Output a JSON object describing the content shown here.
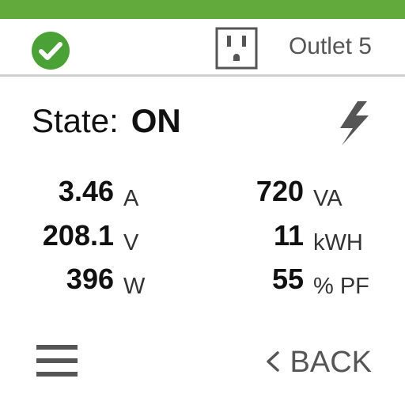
{
  "header": {
    "status_icon": "check-circle-icon",
    "status_color": "#4aa236",
    "accent_color": "#63aa3c",
    "outlet_icon": "power-outlet-icon",
    "outlet_title": "Outlet 5"
  },
  "state": {
    "label": "State:",
    "value": "ON",
    "icon": "lightning-bolt-icon"
  },
  "metrics": {
    "left": [
      {
        "value": "3.46",
        "unit": "A"
      },
      {
        "value": "208.1",
        "unit": "V"
      },
      {
        "value": "396",
        "unit": "W"
      }
    ],
    "right": [
      {
        "value": "720",
        "unit": "VA"
      },
      {
        "value": "11",
        "unit": "kWH"
      },
      {
        "value": "55",
        "unit": "% PF"
      }
    ]
  },
  "footer": {
    "menu_icon": "hamburger-menu-icon",
    "back_label": "BACK",
    "back_icon": "chevron-left-icon"
  }
}
